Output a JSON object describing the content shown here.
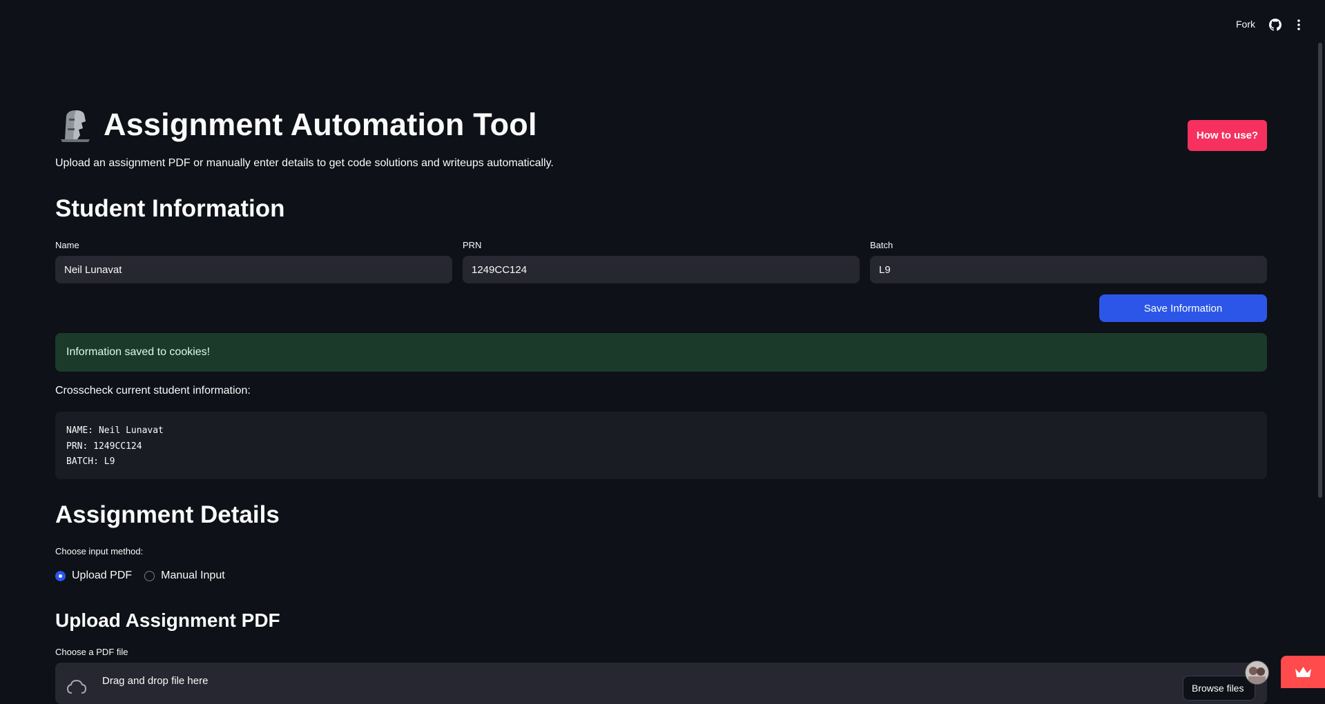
{
  "header": {
    "fork_label": "Fork",
    "github_icon": "github-icon",
    "menu_icon": "kebab-menu-icon"
  },
  "page": {
    "title_icon": "moai-icon",
    "title": "Assignment Automation Tool",
    "howto_label": "How to use?",
    "subtitle": "Upload an assignment PDF or manually enter details to get code solutions and writeups automatically."
  },
  "student": {
    "heading": "Student Information",
    "name_label": "Name",
    "name_value": "Neil Lunavat",
    "prn_label": "PRN",
    "prn_value": "1249CC124",
    "batch_label": "Batch",
    "batch_value": "L9",
    "save_label": "Save Information",
    "success_message": "Information saved to cookies!",
    "crosscheck_label": "Crosscheck current student information:",
    "code_lines": [
      "NAME: Neil Lunavat",
      "PRN: 1249CC124",
      "BATCH: L9"
    ]
  },
  "assignment": {
    "heading": "Assignment Details",
    "method_label": "Choose input method:",
    "options": [
      "Upload PDF",
      "Manual Input"
    ],
    "selected": "Upload PDF"
  },
  "upload": {
    "heading": "Upload Assignment PDF",
    "file_label": "Choose a PDF file",
    "dropzone_text": "Drag and drop file here",
    "browse_label": "Browse files"
  },
  "colors": {
    "background": "#0e1117",
    "accent": "#2c56e8",
    "howto": "#f6315f",
    "success_bg": "#1b3a2a"
  }
}
